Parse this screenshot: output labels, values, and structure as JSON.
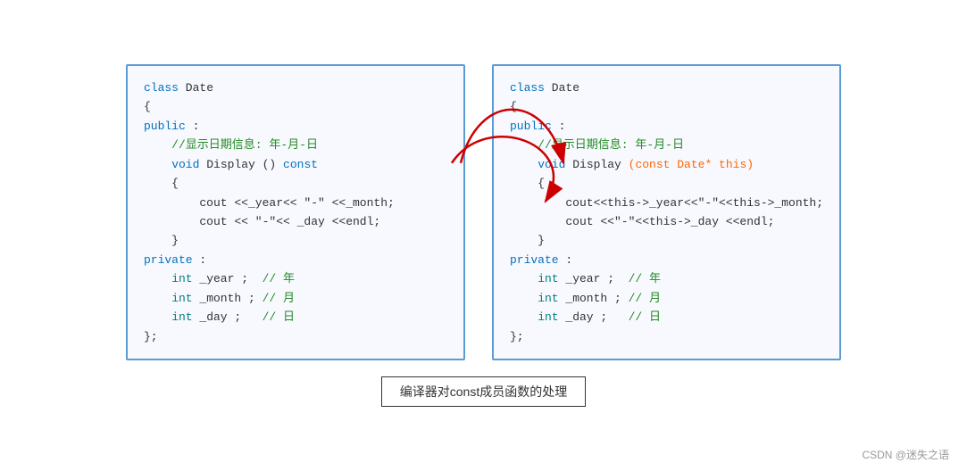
{
  "panel_left": {
    "lines": [
      {
        "type": "kw-blue",
        "text": "class Date"
      },
      {
        "type": "str-dark",
        "text": "{"
      },
      {
        "type": "kw-blue",
        "text": "public :"
      },
      {
        "type": "comment",
        "text": "    //显示日期信息: 年-月-日"
      },
      {
        "type": "mixed_void_display_const",
        "text": "    void Display () const"
      },
      {
        "type": "str-dark",
        "text": "    {"
      },
      {
        "type": "str-dark",
        "text": "        cout <<_year<< \"-\" <<_month;"
      },
      {
        "type": "str-dark",
        "text": "        cout << \"-\"<< _day <<endl;"
      },
      {
        "type": "str-dark",
        "text": "    }"
      },
      {
        "type": "kw-blue",
        "text": "private :"
      },
      {
        "type": "mixed_int",
        "text": "    int _year ;  // 年"
      },
      {
        "type": "mixed_int",
        "text": "    int _month ; // 月"
      },
      {
        "type": "mixed_int",
        "text": "    int _day ;   // 日"
      },
      {
        "type": "str-dark",
        "text": "};"
      }
    ]
  },
  "panel_right": {
    "lines": [
      {
        "type": "kw-blue",
        "text": "class Date"
      },
      {
        "type": "str-dark",
        "text": "{"
      },
      {
        "type": "kw-blue",
        "text": "public :"
      },
      {
        "type": "comment",
        "text": "    //显示日期信息: 年-月-日"
      },
      {
        "type": "mixed_void_display_this",
        "text": "    void Display (const Date* this)"
      },
      {
        "type": "str-dark",
        "text": "    {"
      },
      {
        "type": "str-dark",
        "text": "        cout<<this->_year<<\"-\"<<this->_month;"
      },
      {
        "type": "str-dark",
        "text": "        cout <<\"-\"<<this->_day <<endl;"
      },
      {
        "type": "str-dark",
        "text": "    }"
      },
      {
        "type": "kw-blue",
        "text": "private :"
      },
      {
        "type": "mixed_int",
        "text": "    int _year ;  // 年"
      },
      {
        "type": "mixed_int",
        "text": "    int _month ; // 月"
      },
      {
        "type": "mixed_int",
        "text": "    int _day ;   // 日"
      },
      {
        "type": "str-dark",
        "text": "};"
      }
    ]
  },
  "caption": "编译器对const成员函数的处理",
  "watermark": "CSDN @迷失之语"
}
